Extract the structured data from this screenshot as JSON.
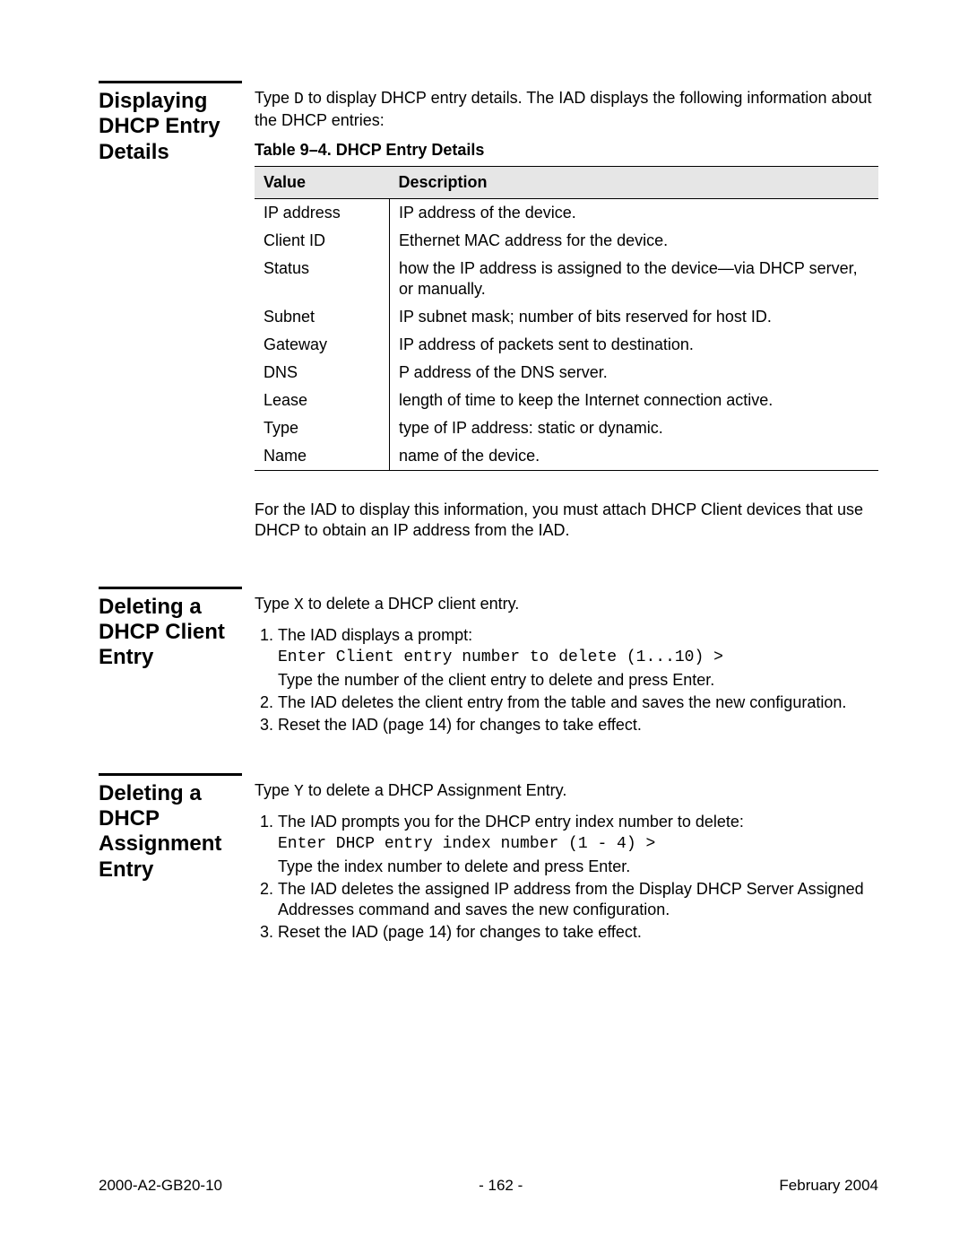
{
  "section1": {
    "heading": "Displaying DHCP Entry Details",
    "intro_a": "Type ",
    "intro_key": "D",
    "intro_b": " to display DHCP entry details. The IAD displays the following information about the DHCP entries:",
    "table_caption": "Table 9–4.  DHCP Entry Details",
    "th_value": "Value",
    "th_desc": "Description",
    "rows": [
      {
        "v": "IP address",
        "d": "IP address of the device."
      },
      {
        "v": "Client ID",
        "d": "Ethernet MAC address for the device."
      },
      {
        "v": "Status",
        "d": "how the IP address is assigned to the device—via DHCP server, or manually."
      },
      {
        "v": "Subnet",
        "d": "IP subnet mask; number of bits reserved for host ID."
      },
      {
        "v": "Gateway",
        "d": "IP address of packets sent to destination."
      },
      {
        "v": "DNS",
        "d": "P address of the DNS server."
      },
      {
        "v": "Lease",
        "d": "length of time to keep the Internet connection active."
      },
      {
        "v": "Type",
        "d": "type of IP address: static or dynamic."
      },
      {
        "v": "Name",
        "d": "name of the device."
      }
    ],
    "note": "For the IAD to display this information, you must attach DHCP Client devices that use DHCP to obtain an IP address from the IAD."
  },
  "section2": {
    "heading": "Deleting a DHCP Cli­ent Entry",
    "intro_a": "Type ",
    "intro_key": "X",
    "intro_b": " to delete a DHCP client entry.",
    "step1_a": "The IAD displays a prompt:",
    "step1_prompt": "Enter Client entry number to delete (1...10) >",
    "step1_b": "Type the number of the client entry to delete and press Enter.",
    "step2": "The IAD deletes the client entry from the table and saves the new configuration.",
    "step3": "Reset the IAD (page 14) for changes to take effect."
  },
  "section3": {
    "heading": "Deleting a DHCP Assign­ment Entry",
    "intro_a": "Type ",
    "intro_key": "Y",
    "intro_b": " to delete a DHCP Assignment Entry.",
    "step1_a": "The IAD prompts you for the DHCP entry index number to delete:",
    "step1_prompt": "Enter DHCP entry index number (1 - 4) >",
    "step1_b": "Type the index number to delete and press Enter.",
    "step2": "The IAD deletes the assigned IP address from the Display DHCP Server Assigned Addresses command and saves the new configuration.",
    "step3": "Reset the IAD (page 14) for changes to take effect."
  },
  "footer": {
    "left": "2000-A2-GB20-10",
    "center": "- 162 -",
    "right": "February 2004"
  }
}
